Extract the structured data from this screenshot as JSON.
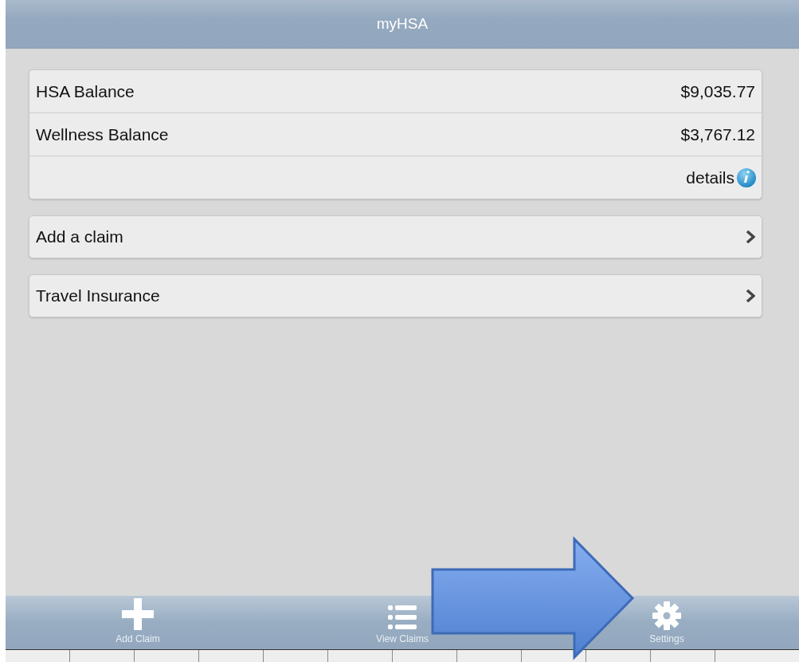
{
  "header": {
    "title": "myHSA"
  },
  "balances": [
    {
      "label": "HSA Balance",
      "value": "$9,035.77"
    },
    {
      "label": "Wellness Balance",
      "value": "$3,767.12"
    }
  ],
  "details_link": "details",
  "menu_items": [
    {
      "label": "Add a claim"
    },
    {
      "label": "Travel Insurance"
    }
  ],
  "tab_bar": [
    {
      "kind": "plus",
      "label": "Add Claim"
    },
    {
      "kind": "list",
      "label": "View Claims"
    },
    {
      "kind": "gear",
      "label": "Settings"
    }
  ]
}
